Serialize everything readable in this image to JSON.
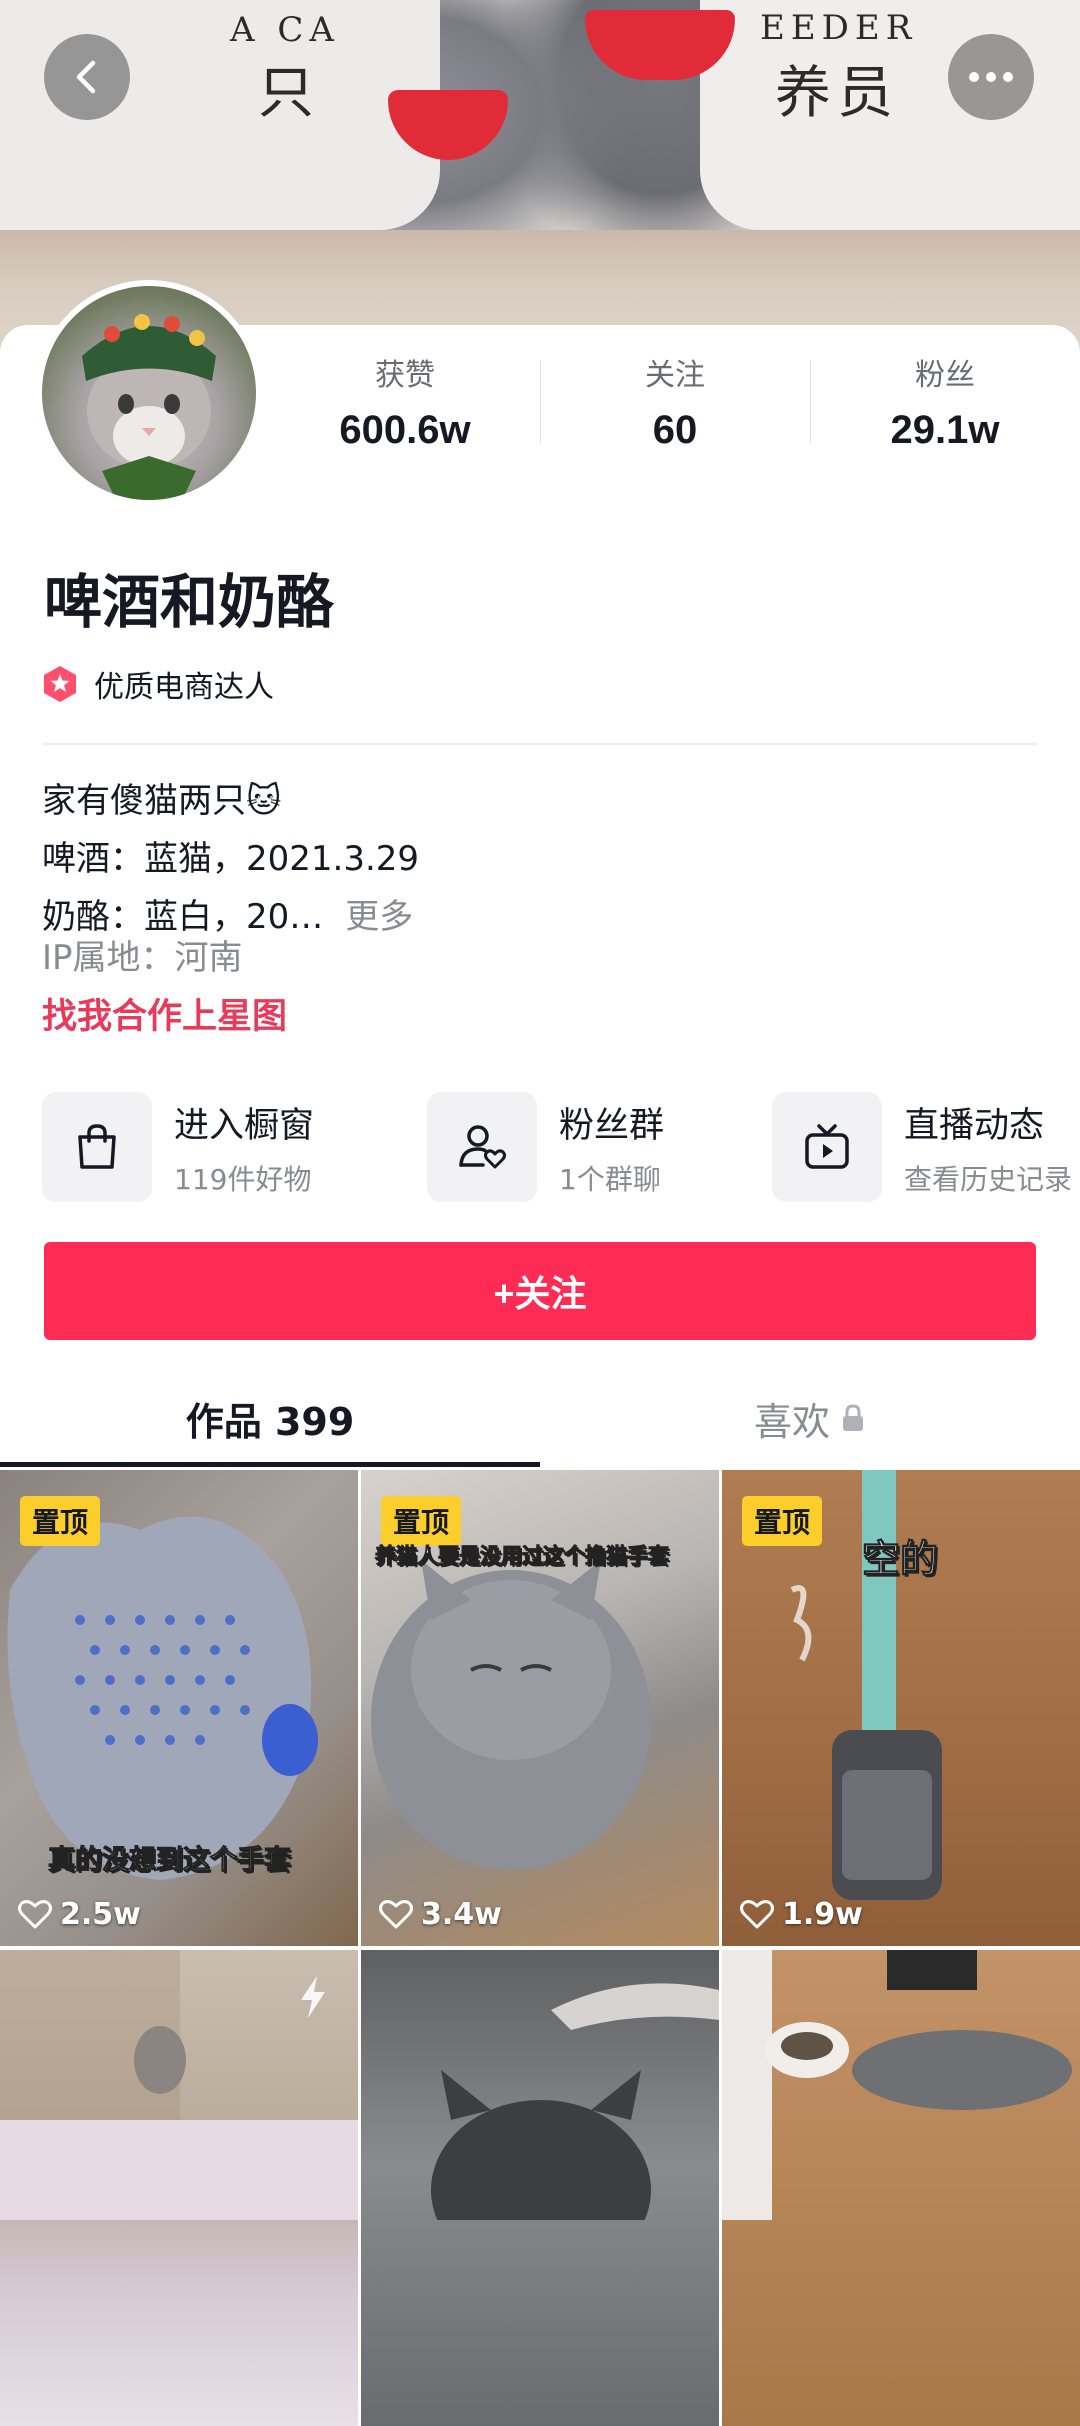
{
  "cover": {
    "words": [
      "A CA",
      "只",
      "EEDER",
      "养员"
    ]
  },
  "profile": {
    "name": "啤酒和奶酪",
    "badge": "优质电商达人",
    "stats": [
      {
        "label": "获赞",
        "value": "600.6w"
      },
      {
        "label": "关注",
        "value": "60"
      },
      {
        "label": "粉丝",
        "value": "29.1w"
      }
    ],
    "bio": {
      "line1": "家有傻猫两只",
      "line1_emoji": "🐱",
      "line2": "啤酒：蓝猫，2021.3.29",
      "line3": "奶酪：蓝白，20…",
      "more": "更多"
    },
    "ip": "IP属地：河南",
    "cooperation_link": "找我合作上星图"
  },
  "entries": [
    {
      "title": "进入橱窗",
      "subtitle": "119件好物",
      "icon": "shopping-bag-icon"
    },
    {
      "title": "粉丝群",
      "subtitle": "1个群聊",
      "icon": "fan-group-icon"
    },
    {
      "title": "直播动态",
      "subtitle": "查看历史记录",
      "icon": "tv-icon"
    }
  ],
  "follow_button": "+关注",
  "tabs": [
    {
      "label": "作品 399",
      "active": true
    },
    {
      "label": "喜欢",
      "active": false,
      "icon": "lock-icon"
    }
  ],
  "videos": [
    {
      "pinned": "置顶",
      "caption": "真的没想到这个手套",
      "likes": "2.5w"
    },
    {
      "pinned": "置顶",
      "caption": "养猫人要是没用过这个撸猫手套",
      "likes": "3.4w"
    },
    {
      "pinned": "置顶",
      "caption": "空的",
      "likes": "1.9w"
    },
    {
      "icon": "flash-icon"
    },
    {},
    {}
  ],
  "colors": {
    "accent": "#fe2c55",
    "link": "#e83a5a",
    "pin": "#fbce2c"
  }
}
